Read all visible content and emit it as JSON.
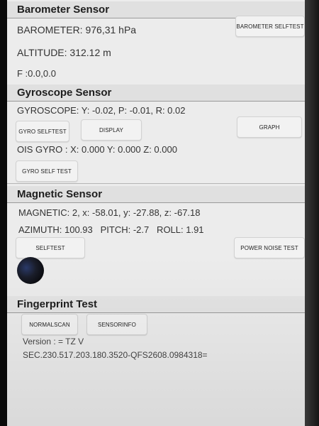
{
  "barometer": {
    "header": "Barometer Sensor",
    "reading": "BAROMETER: 976,31 hPa",
    "altitude": "ALTITUDE: 312.12 m",
    "f_value": "F :0.0,0.0",
    "selftest_button": "BAROMETER SELFTEST"
  },
  "gyroscope": {
    "header": "Gyroscope Sensor",
    "reading": "GYROSCOPE: Y: -0.02, P: -0.01, R: 0.02",
    "selftest_button": "GYRO SELFTEST",
    "display_button": "DISPLAY",
    "graph_button": "GRAPH",
    "ois_reading": "OIS GYRO : X: 0.000 Y: 0.000 Z: 0.000",
    "ois_selftest_button": "GYRO SELF TEST"
  },
  "magnetic": {
    "header": "Magnetic Sensor",
    "reading": "MAGNETIC: 2, x: -58.01, y: -27.88, z: -67.18",
    "azimuth_line": "AZIMUTH: 100.93   PITCH: -2.7   ROLL: 1.91",
    "selftest_button": "SELFTEST",
    "power_noise_button": "POWER NOISE TEST"
  },
  "fingerprint": {
    "header": "Fingerprint Test",
    "normalscan_button": "NORMALSCAN",
    "sensorinfo_button": "SENSORINFO",
    "version": "Version : = TZ V",
    "build": "SEC.230.517.203.180.3520-QFS2608.0984318="
  }
}
